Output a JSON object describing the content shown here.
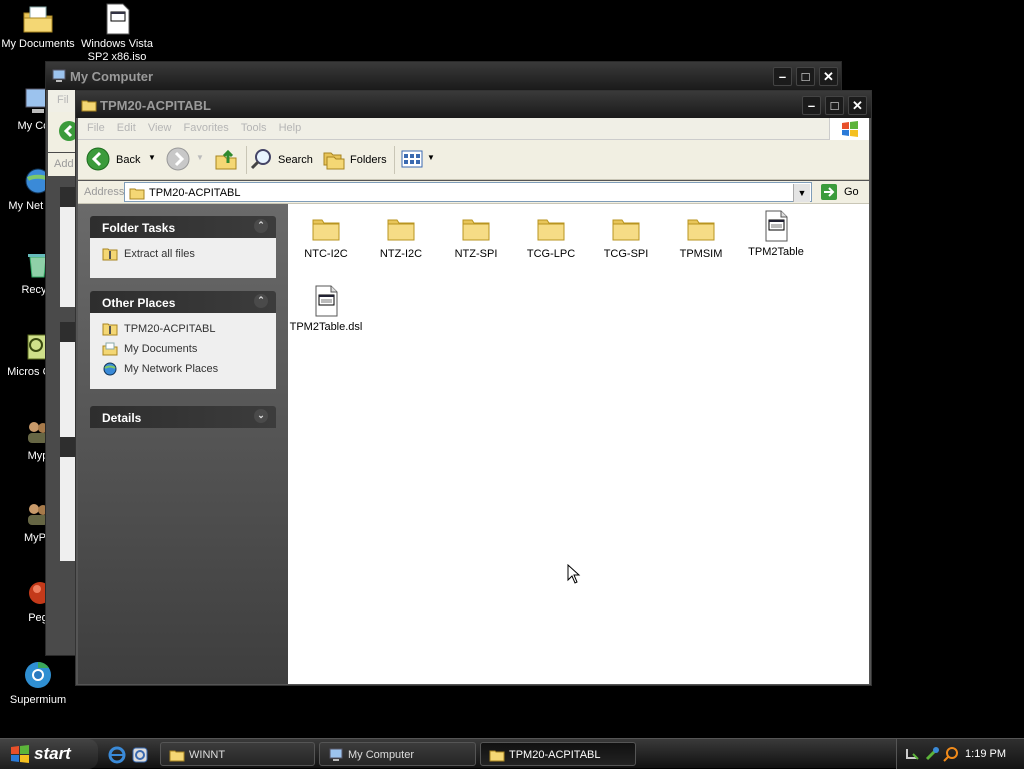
{
  "desktop": {
    "icons": [
      {
        "label": "My Documents"
      },
      {
        "label": "Windows Vista SP2 x86.iso"
      },
      {
        "label": "My Com"
      },
      {
        "label": "My Net Plac"
      },
      {
        "label": "Recycl"
      },
      {
        "label": "Micros Outlo"
      },
      {
        "label": "Myp"
      },
      {
        "label": "MyPa"
      },
      {
        "label": "Peg"
      },
      {
        "label": "Supermium"
      }
    ]
  },
  "back_window": {
    "title": "My Computer",
    "menu_partial": "Fil",
    "address_partial": "Add"
  },
  "window": {
    "title": "TPM20-ACPITABL",
    "menu": [
      "File",
      "Edit",
      "View",
      "Favorites",
      "Tools",
      "Help"
    ],
    "toolbar": {
      "back": "Back",
      "search": "Search",
      "folders": "Folders"
    },
    "address": {
      "label": "Address",
      "value": "TPM20-ACPITABL",
      "go": "Go"
    },
    "folder_tasks": {
      "title": "Folder Tasks",
      "items": [
        "Extract all files"
      ]
    },
    "other_places": {
      "title": "Other Places",
      "items": [
        "TPM20-ACPITABL",
        "My Documents",
        "My Network Places"
      ]
    },
    "details": {
      "title": "Details"
    },
    "files": [
      {
        "name": "NTC-I2C",
        "type": "folder"
      },
      {
        "name": "NTZ-I2C",
        "type": "folder"
      },
      {
        "name": "NTZ-SPI",
        "type": "folder"
      },
      {
        "name": "TCG-LPC",
        "type": "folder"
      },
      {
        "name": "TCG-SPI",
        "type": "folder"
      },
      {
        "name": "TPMSIM",
        "type": "folder"
      },
      {
        "name": "TPM2Table",
        "type": "file"
      },
      {
        "name": "TPM2Table.dsl",
        "type": "file"
      }
    ]
  },
  "taskbar": {
    "start": "start",
    "tasks": [
      "WINNT",
      "My Computer",
      "TPM20-ACPITABL"
    ],
    "clock": "1:19 PM"
  }
}
